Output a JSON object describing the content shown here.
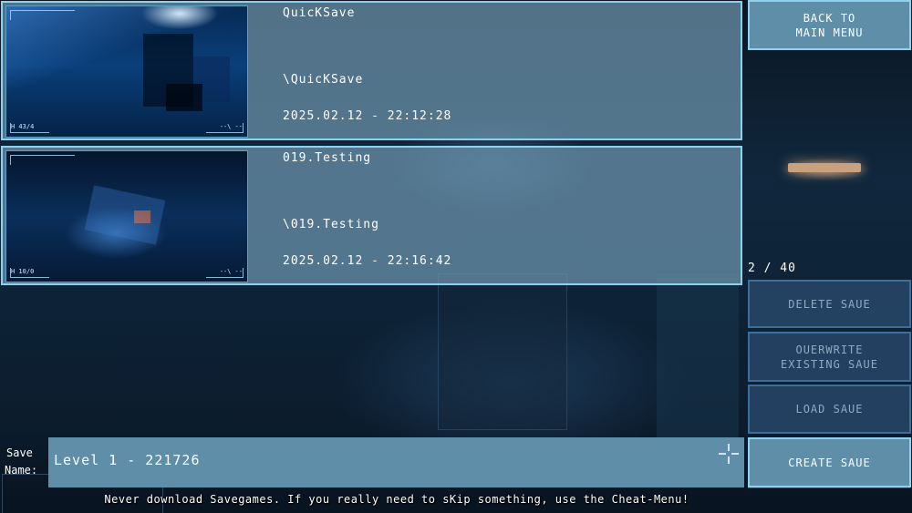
{
  "saves": [
    {
      "name": "QuicKSave",
      "path": "\\QuicKSave",
      "date": "2025.02.12 - 22:12:28",
      "thumb_hud_left": "H 43/4",
      "thumb_hud_right": "--\\ --"
    },
    {
      "name": "019.Testing",
      "path": "\\019.Testing",
      "date": "2025.02.12 - 22:16:42",
      "thumb_hud_left": "H 10/0",
      "thumb_hud_right": "--\\ --"
    }
  ],
  "sidebar": {
    "back_label": "BACK TO\nMAIN MENU",
    "page_count": "2 / 40",
    "delete_label": "DELETE SAUE",
    "overwrite_label": "OUERWRITE\nEXISTING SAUE",
    "load_label": "LOAD SAUE",
    "create_label": "CREATE SAUE"
  },
  "save_name": {
    "label_line1": "Save",
    "label_line2": "Name:",
    "value": "Level 1 - 221726"
  },
  "footer": {
    "warning": "Never download Savegames. If you really need to sKip something, use the Cheat-Menu!"
  },
  "icons": {
    "crosshair": "crosshair-icon"
  },
  "colors": {
    "slot_bg": "#6e96af",
    "accent_border": "#8fd0ee",
    "button_active": "#5e8ea8",
    "button_disabled": "#284669"
  }
}
